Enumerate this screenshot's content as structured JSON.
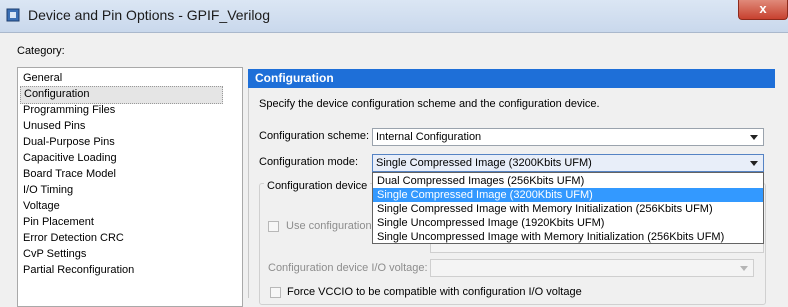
{
  "window": {
    "title": "Device and Pin Options - GPIF_Verilog",
    "close_label": "x"
  },
  "category": {
    "label": "Category:",
    "items": [
      "General",
      "Configuration",
      "Programming Files",
      "Unused Pins",
      "Dual-Purpose Pins",
      "Capacitive Loading",
      "Board Trace Model",
      "I/O Timing",
      "Voltage",
      "Pin Placement",
      "Error Detection CRC",
      "CvP Settings",
      "Partial Reconfiguration"
    ],
    "selected": "Configuration"
  },
  "panel": {
    "header": "Configuration",
    "description": "Specify the device configuration scheme and the configuration device.",
    "scheme_label": "Configuration scheme:",
    "scheme_value": "Internal Configuration",
    "mode_label": "Configuration mode:",
    "mode_value": "Single Compressed Image (3200Kbits UFM)",
    "device_group_title": "Configuration device",
    "use_device_label": "Use configuration",
    "io_voltage_label": "Configuration device I/O voltage:",
    "io_voltage_value": "",
    "force_vccio_label": "Force VCCIO to be compatible with configuration I/O voltage"
  },
  "mode_dropdown": {
    "options": [
      "Dual Compressed Images (256Kbits UFM)",
      "Single Compressed Image (3200Kbits UFM)",
      "Single Compressed Image with Memory Initialization (256Kbits UFM)",
      "Single Uncompressed Image (1920Kbits UFM)",
      "Single Uncompressed Image with Memory Initialization (256Kbits UFM)"
    ],
    "selected_index": 1
  },
  "colors": {
    "accent": "#1e6fd8",
    "selection": "#3399ff"
  }
}
